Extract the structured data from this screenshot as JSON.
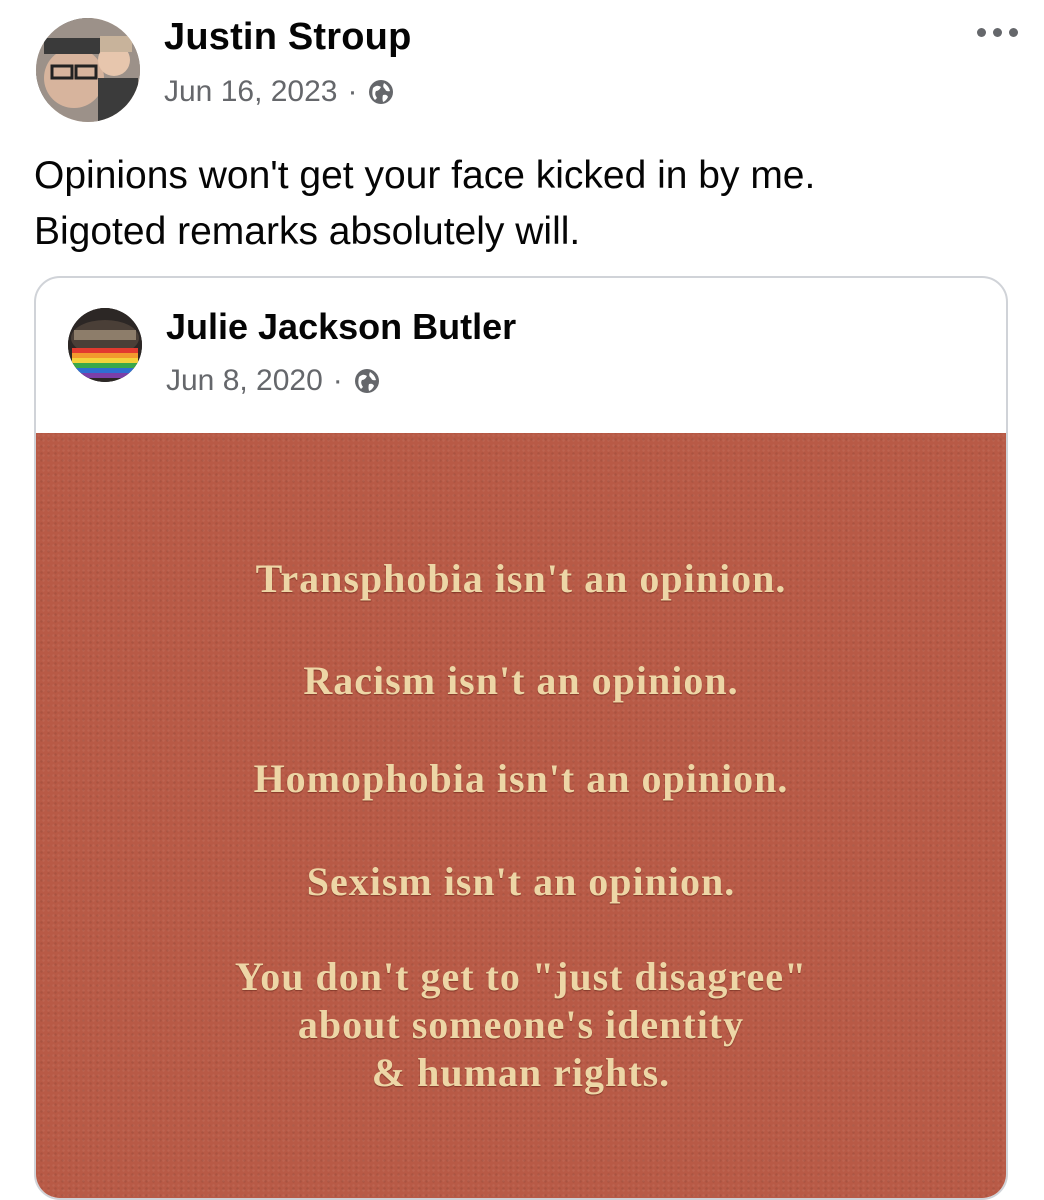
{
  "post": {
    "author": "Justin Stroup",
    "date": "Jun 16, 2023",
    "separator": "·",
    "privacy_icon": "globe-icon",
    "more_icon": "more-options-icon",
    "text_line1": "Opinions won't get your face kicked in by me.",
    "text_line2": "Bigoted remarks absolutely will."
  },
  "shared_post": {
    "author": "Julie Jackson Butler",
    "date": "Jun 8, 2020",
    "separator": "·",
    "privacy_icon": "globe-icon",
    "image_lines": [
      "Transphobia isn't an opinion.",
      "Racism isn't an opinion.",
      "Homophobia isn't an opinion.",
      "Sexism isn't an opinion.",
      "You don't get to \"just disagree\"",
      "about someone's identity",
      "& human rights."
    ],
    "image_background_color": "#b85a46",
    "image_text_color": "#edd6a6"
  }
}
